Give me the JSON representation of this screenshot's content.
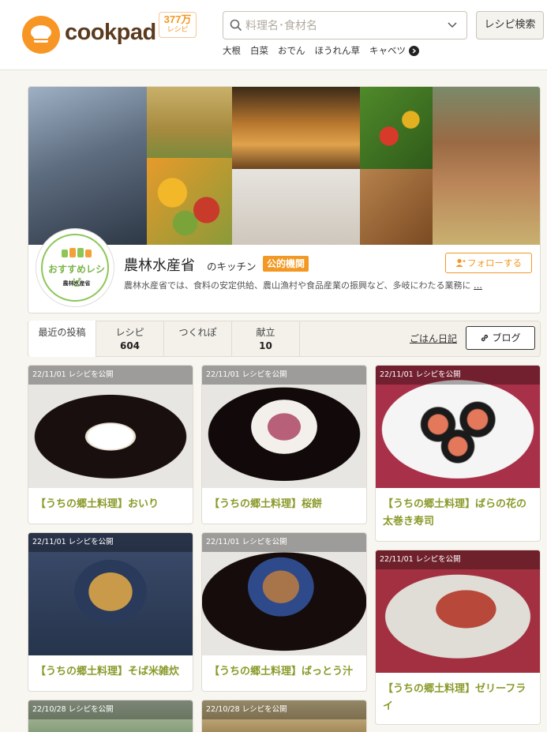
{
  "header": {
    "logo_text": "cookpad",
    "recipe_count": "377万",
    "recipe_count_unit": "レシピ",
    "search_placeholder": "料理名･食材名",
    "search_button": "レシピ検索",
    "keywords": [
      "大根",
      "白菜",
      "おでん",
      "ほうれん草",
      "キャベツ"
    ]
  },
  "kitchen": {
    "avatar_main": "おすすめレシピ",
    "avatar_sub": "農林水産省",
    "name": "農林水産省",
    "name_suffix": "のキッチン",
    "badge": "公的機関",
    "follow_label": "フォローする",
    "description": "農林水産省では、食料の安定供給、農山漁村や食品産業の振興など、多岐にわたる業務に",
    "more": "…"
  },
  "stats": {
    "tabs": [
      {
        "label": "最近の投稿",
        "value": ""
      },
      {
        "label": "レシピ",
        "value": "604"
      },
      {
        "label": "つくれぽ",
        "value": ""
      },
      {
        "label": "献立",
        "value": "10"
      }
    ],
    "diary_link": "ごはん日記",
    "blog_label": "ブログ"
  },
  "recipes": [
    {
      "date": "22/11/01 レシピを公開",
      "title": "【うちの郷土料理】おいり"
    },
    {
      "date": "22/11/01 レシピを公開",
      "title": "【うちの郷土料理】桜餅"
    },
    {
      "date": "22/11/01 レシピを公開",
      "title_line1": "【うちの郷土料理】ばらの花の",
      "title_line2": "太巻き寿司"
    },
    {
      "date": "22/11/01 レシピを公開",
      "title": "【うちの郷土料理】そば米雑炊"
    },
    {
      "date": "22/11/01 レシピを公開",
      "title": "【うちの郷土料理】ばっとう汁"
    },
    {
      "date": "22/11/01 レシピを公開",
      "title_line1": "【うちの郷土料理】ゼリーフラ",
      "title_line2": "イ"
    },
    {
      "date": "22/10/28 レシピを公開",
      "title": ""
    },
    {
      "date": "22/10/28 レシピを公開",
      "title": ""
    }
  ],
  "colors": {
    "brand_orange": "#f39823",
    "title_green": "#8a9a2a",
    "background": "#f8f6f1"
  }
}
